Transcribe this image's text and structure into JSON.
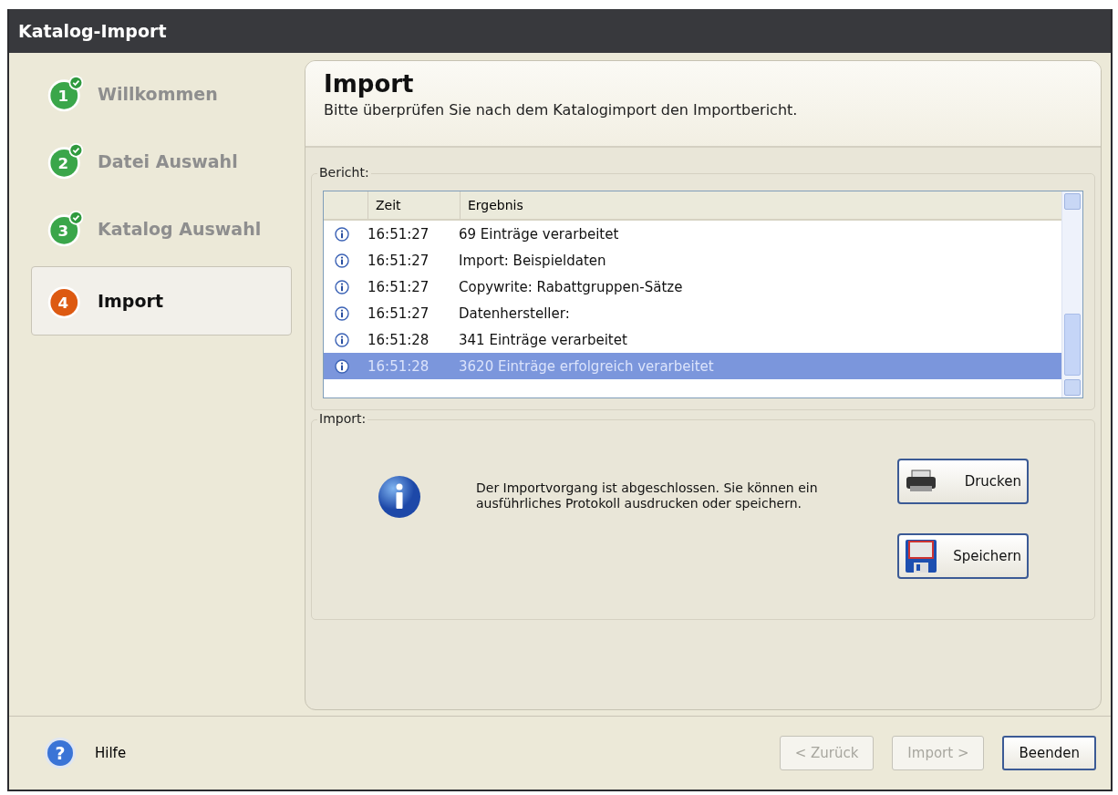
{
  "window": {
    "title": "Katalog-Import"
  },
  "steps": [
    {
      "number": "1",
      "label": "Willkommen",
      "done": true,
      "selected": false
    },
    {
      "number": "2",
      "label": "Datei Auswahl",
      "done": true,
      "selected": false
    },
    {
      "number": "3",
      "label": "Katalog Auswahl",
      "done": true,
      "selected": false
    },
    {
      "number": "4",
      "label": "Import",
      "done": false,
      "selected": true
    }
  ],
  "header": {
    "title": "Import",
    "subtitle": "Bitte überprüfen Sie nach dem Katalogimport den Importbericht."
  },
  "report": {
    "label": "Bericht:",
    "columns": [
      "Zeit",
      "Ergebnis"
    ],
    "rows": [
      {
        "time": "16:51:27",
        "result": "69 Einträge verarbeitet",
        "selected": false
      },
      {
        "time": "16:51:27",
        "result": "Import: Beispieldaten",
        "selected": false
      },
      {
        "time": "16:51:27",
        "result": "Copywrite: Rabattgruppen-Sätze",
        "selected": false
      },
      {
        "time": "16:51:27",
        "result": "Datenhersteller:",
        "selected": false
      },
      {
        "time": "16:51:28",
        "result": "341 Einträge verarbeitet",
        "selected": false
      },
      {
        "time": "16:51:28",
        "result": "3620 Einträge erfolgreich verarbeitet",
        "selected": true
      }
    ]
  },
  "import_group": {
    "label": "Import:",
    "message": "Der Importvorgang ist abgeschlossen. Sie können ein ausführliches Protokoll ausdrucken oder speichern.",
    "actions": [
      {
        "kind": "print",
        "label": "Drucken"
      },
      {
        "kind": "save",
        "label": "Speichern"
      }
    ]
  },
  "footer": {
    "help_icon": "?",
    "help": "Hilfe",
    "buttons": [
      {
        "label": "< Zurück",
        "disabled": true,
        "default": false
      },
      {
        "label": "Import >",
        "disabled": true,
        "default": false
      },
      {
        "label": "Beenden",
        "disabled": false,
        "default": true
      }
    ]
  }
}
